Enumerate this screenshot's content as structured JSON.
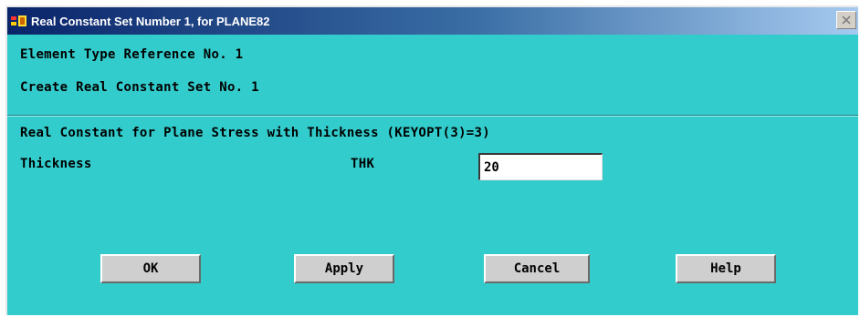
{
  "window": {
    "title": "Real Constant Set Number 1, for PLANE82",
    "close_glyph": "✕"
  },
  "header": {
    "element_type_ref": "Element Type Reference No. 1",
    "create_set": "Create Real Constant Set No. 1"
  },
  "section": {
    "heading": "Real Constant for Plane Stress with Thickness (KEYOPT(3)=3)"
  },
  "fields": [
    {
      "label": "Thickness",
      "symbol": "THK",
      "value": "20"
    }
  ],
  "buttons": {
    "ok": "OK",
    "apply": "Apply",
    "cancel": "Cancel",
    "help": "Help"
  },
  "colors": {
    "dialog_bg": "#33cccc",
    "titlebar_start": "#0a246a",
    "titlebar_end": "#a6caf0",
    "button_bg": "#cfcfcf"
  },
  "icons": {
    "app": "ansys-app-icon",
    "close": "close-icon"
  }
}
